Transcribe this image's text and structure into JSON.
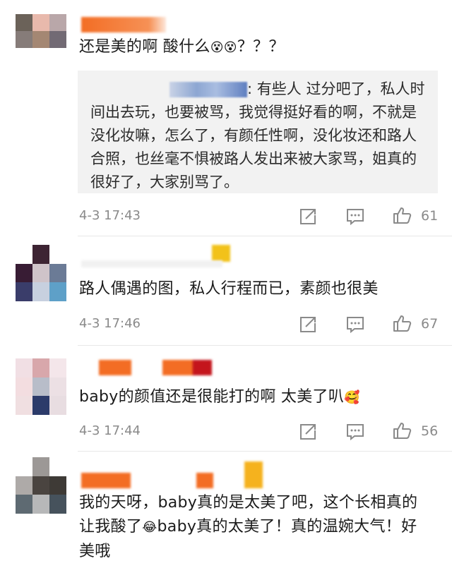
{
  "comments": [
    {
      "text": "还是美的啊 酸什么",
      "emoji": "😵😵",
      "suffix": "？？？",
      "quote_sep": ": ",
      "quote": "有些人 过分吧了，私人时间出去玩，也要被骂，我觉得挺好看的啊，不就是没化妆嘛，怎么了，有颜任性啊，没化妆还和路人合照，也丝毫不惧被路人发出来被大家骂，姐真的很好了，大家别骂了。",
      "time": "4-3 17:43",
      "likes": "61"
    },
    {
      "text": "路人偶遇的图，私人行程而已，素颜也很美",
      "time": "4-3 17:46",
      "likes": "67"
    },
    {
      "text": "baby的颜值还是很能打的啊 太美了叭",
      "emoji": "🥰",
      "time": "4-3 17:44",
      "likes": "56"
    },
    {
      "text_a": "我的天呀，baby真的是太美了吧，这个长相真的让我酸了",
      "emoji": "😂",
      "text_b": "baby真的太美了！真的温婉大气！好美哦"
    }
  ],
  "colors": {
    "accent_name": "#f36d24",
    "meta_gray": "#8a8a8a",
    "quote_bg": "#f2f2f2"
  },
  "icons": [
    "repost-icon",
    "comment-icon",
    "like-icon"
  ]
}
